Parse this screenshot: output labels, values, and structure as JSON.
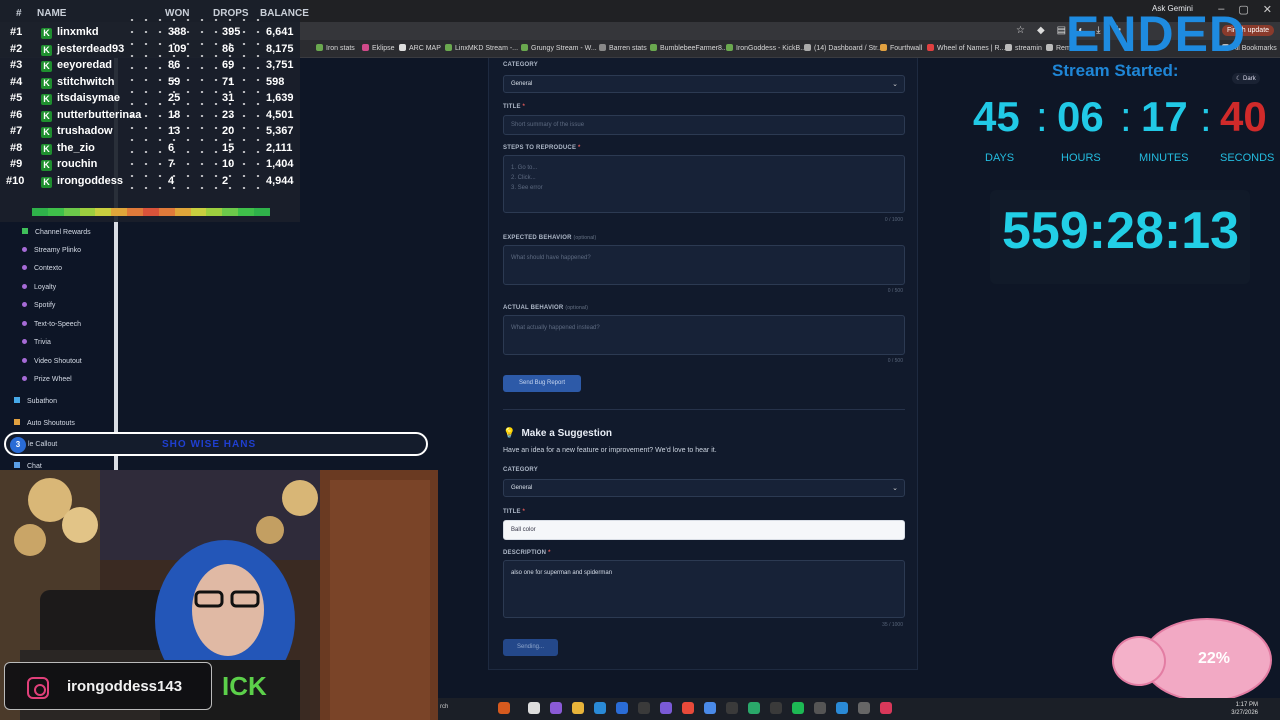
{
  "browser": {
    "ask_gemini": "Ask Gemini",
    "finish_update": "Finish update",
    "all_bookmarks": "All Bookmarks",
    "bookmarks": [
      "Iron stats",
      "Eklipse",
      "ARC MAP",
      "LinxMKD Stream -...",
      "Grungy Stream - W...",
      "Barren stats",
      "BumblebeeFarmer8...",
      "IronGoddess - KickB...",
      "(14) Dashboard / Str...",
      "Fourthwall",
      "Wheel of Names | R...",
      "streamin",
      "Remov..."
    ]
  },
  "leaderboard": {
    "headers": {
      "rank": "#",
      "name": "NAME",
      "won": "WON",
      "drops": "DROPS",
      "balance": "BALANCE"
    },
    "rows": [
      {
        "rank": "#1",
        "name": "linxmkd",
        "won": "388",
        "drops": "395",
        "balance": "6,641"
      },
      {
        "rank": "#2",
        "name": "jesterdead93",
        "won": "109",
        "drops": "86",
        "balance": "8,175"
      },
      {
        "rank": "#3",
        "name": "eeyoredad",
        "won": "86",
        "drops": "69",
        "balance": "3,751"
      },
      {
        "rank": "#4",
        "name": "stitchwitch",
        "won": "59",
        "drops": "71",
        "balance": "598"
      },
      {
        "rank": "#5",
        "name": "itsdaisymae",
        "won": "25",
        "drops": "31",
        "balance": "1,639"
      },
      {
        "rank": "#6",
        "name": "nutterbutterinaa",
        "won": "18",
        "drops": "23",
        "balance": "4,501"
      },
      {
        "rank": "#7",
        "name": "trushadow",
        "won": "13",
        "drops": "20",
        "balance": "5,367"
      },
      {
        "rank": "#8",
        "name": "the_zio",
        "won": "6",
        "drops": "15",
        "balance": "2,111"
      },
      {
        "rank": "#9",
        "name": "rouchin",
        "won": "7",
        "drops": "10",
        "balance": "1,404"
      },
      {
        "rank": "#10",
        "name": "irongoddess",
        "won": "4",
        "drops": "2",
        "balance": "4,944"
      }
    ],
    "k_badge": "K",
    "bar_colors": [
      "#2fb24a",
      "#3fc04a",
      "#6cc94a",
      "#9dcf3f",
      "#c9cf3f",
      "#e0a63a",
      "#e07a3a",
      "#d9533a",
      "#e07a3a",
      "#e0a63a",
      "#c9cf3f",
      "#9dcf3f",
      "#6cc94a",
      "#3fc04a",
      "#2fb24a"
    ]
  },
  "sidebar": {
    "items": [
      "Channel Rewards",
      "Streamy Plinko",
      "Contexto",
      "Loyalty",
      "Spotify",
      "Text-to-Speech",
      "Trivia",
      "Video Shoutout",
      "Prize Wheel",
      "Subathon",
      "Auto Shoutouts",
      "Chat"
    ]
  },
  "callout": {
    "number": "3",
    "label": "le Callout",
    "text": "SHO WISE HANS"
  },
  "bug_form": {
    "category_label": "CATEGORY",
    "category_value": "General",
    "title_label": "TITLE",
    "title_placeholder": "Short summary of the issue",
    "steps_label": "STEPS TO REPRODUCE",
    "steps_placeholder": "1. Go to...\n2. Click...\n3. See error",
    "steps_counter": "0 / 1000",
    "expected_label": "EXPECTED BEHAVIOR",
    "expected_optional": "(optional)",
    "expected_placeholder": "What should have happened?",
    "expected_counter": "0 / 500",
    "actual_label": "ACTUAL BEHAVIOR",
    "actual_optional": "(optional)",
    "actual_placeholder": "What actually happened instead?",
    "actual_counter": "0 / 500",
    "submit": "Send Bug Report"
  },
  "suggestion_form": {
    "heading": "Make a Suggestion",
    "subheading": "Have an idea for a new feature or improvement? We'd love to hear it.",
    "category_label": "CATEGORY",
    "category_value": "General",
    "title_label": "TITLE",
    "title_value": "Ball color",
    "description_label": "DESCRIPTION",
    "description_value": "also one for superman and spiderman",
    "description_counter": "35 / 1000",
    "submit": "Sending..."
  },
  "timers": {
    "ended": "ENDED",
    "stream_started": "Stream Started:",
    "dark_label": "Dark",
    "days": "45",
    "hours": "06",
    "minutes": "17",
    "seconds": "40",
    "days_label": "DAYS",
    "hours_label": "HOURS",
    "minutes_label": "MINUTES",
    "seconds_label": "SECONDS",
    "total": "559:28:13"
  },
  "instagram": {
    "handle": "irongoddess143"
  },
  "piggy": {
    "percent": "22%"
  },
  "taskbar": {
    "search": "rch",
    "time": "1:17 PM",
    "date": "3/27/2026"
  }
}
